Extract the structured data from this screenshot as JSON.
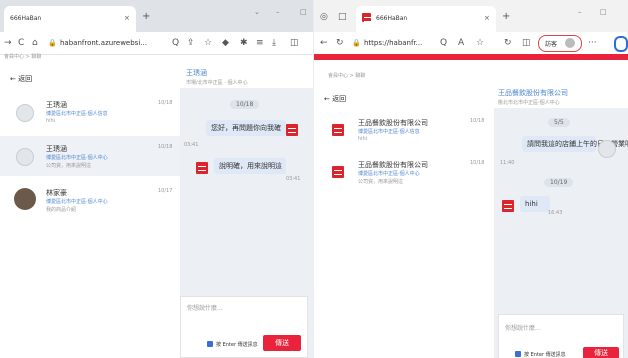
{
  "left": {
    "tab_title": "666HaBan",
    "url": "habanfront.azurewebsi...",
    "breadcrumb": "會員中心 > 聊聊",
    "back_label": "返回",
    "header_name": "王琇涵",
    "header_sub": "市場/北市中正區 · 個人中心",
    "date_pill": "10/18",
    "msg1": "您好，再問題你向我確",
    "msg1_time": "03:41",
    "msg2": "說明確，用來說明這",
    "msg2_time": "03:41",
    "input_placeholder": "你想說什麼...",
    "enter_label": "按 Enter 傳送訊息",
    "send_label": "傳送",
    "list": [
      {
        "name": "王琇涵",
        "sub": "博愛區北市中正區·個人信息",
        "preview": "hihi",
        "date": "10/18"
      },
      {
        "name": "王琇涵",
        "sub": "博愛區北市中正區·個人中心",
        "preview": "公司資，用來說明這",
        "date": "10/18"
      },
      {
        "name": "林家豪",
        "sub": "博愛區北市中正區·個人中心",
        "preview": "我的商品介紹",
        "date": "10/17"
      }
    ]
  },
  "right": {
    "tab_title": "666HaBan",
    "url": "https://habanfr...",
    "profile_label": "訪客",
    "breadcrumb": "會員中心 > 聊聊",
    "back_label": "返回",
    "header_name": "王品餐飲股份有限公司",
    "header_sub": "桃北市北市中正區·個人中心",
    "date_pill1": "5/5",
    "msg1": "請問我這的店鋪上午的日有營業嗎？",
    "msg1_time": "11:40",
    "date_pill2": "10/19",
    "msg2": "hihi",
    "msg2_time": "16:43",
    "input_placeholder": "你想說什麼...",
    "enter_label": "按 Enter 傳送訊息",
    "send_label": "傳送",
    "list": [
      {
        "name": "王品餐飲股份有限公司",
        "sub": "博愛區北市中正區·個人信息",
        "preview": "hihi",
        "date": "10/18"
      },
      {
        "name": "王品餐飲股份有限公司",
        "sub": "博愛區北市中正區·個人中心",
        "preview": "公司資，用來說明這",
        "date": "10/18"
      }
    ]
  },
  "colors": {
    "accent": "#e8233b",
    "link": "#4a86d0",
    "bubble": "#dfe8f7"
  }
}
